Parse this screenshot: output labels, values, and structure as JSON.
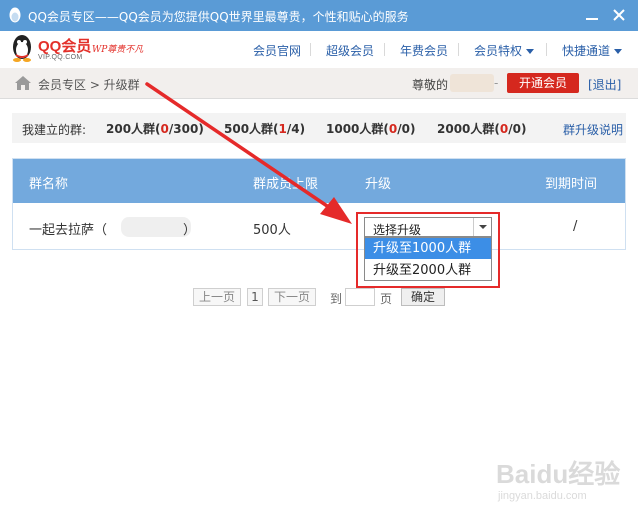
{
  "window": {
    "title": "QQ会员专区——QQ会员为您提供QQ世界里最尊贵，个性和贴心的服务",
    "minimize_icon": "minimize-icon",
    "close_icon": "close-icon"
  },
  "header": {
    "logo": {
      "brand": "QQ会员",
      "domain": "VIP.QQ.COM",
      "slogan": "WP尊贵不凡"
    },
    "nav": [
      {
        "label": "会员官网"
      },
      {
        "label": "超级会员"
      },
      {
        "label": "年费会员"
      },
      {
        "label": "会员特权",
        "dropdown": true
      },
      {
        "label": "快捷通道",
        "dropdown": true
      }
    ]
  },
  "breadcrumb": {
    "home_icon": "home-icon",
    "text": "会员专区 > 升级群",
    "greeting": "尊敬的",
    "dash": "-",
    "open_vip": "开通会员",
    "logout": "[退出]"
  },
  "groups_summary": {
    "label": "我建立的群:",
    "stats": [
      {
        "prefix": "200人群(",
        "num": "0",
        "suffix": "/300)"
      },
      {
        "prefix": "500人群(",
        "num": "1",
        "suffix": "/4)"
      },
      {
        "prefix": "1000人群(",
        "num": "0",
        "suffix": "/0)"
      },
      {
        "prefix": "2000人群(",
        "num": "0",
        "suffix": "/0)"
      }
    ],
    "help_link": "群升级说明"
  },
  "table": {
    "headers": {
      "name": "群名称",
      "limit": "群成员上限",
      "upgrade": "升级",
      "expiry": "到期时间"
    },
    "rows": [
      {
        "name": "一起去拉萨（",
        "name_tail": "）",
        "limit": "500人",
        "expiry": "/"
      }
    ]
  },
  "upgrade_select": {
    "value": "选择升级",
    "options": [
      "升级至1000人群",
      "升级至2000人群"
    ],
    "highlighted_index": 0
  },
  "pagination": {
    "prev": "上一页",
    "current": "1",
    "next": "下一页",
    "goto_prefix": "到",
    "goto_suffix": "页",
    "confirm": "确定"
  },
  "watermark": {
    "text": "Baidu经验",
    "url": "jingyan.baidu.com"
  },
  "colors": {
    "titlebar": "#5a9bd6",
    "table_header": "#73a9dd",
    "accent_red": "#d5281e",
    "link_blue": "#2a5fa8",
    "annotation_red": "#e52a2a",
    "option_highlight": "#3c8ee6"
  }
}
